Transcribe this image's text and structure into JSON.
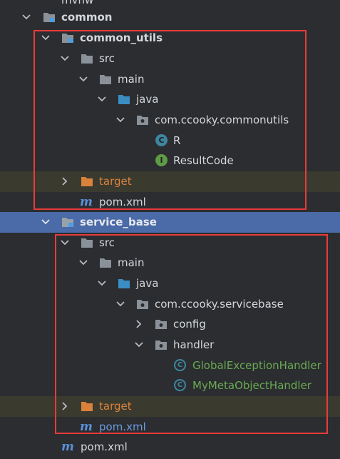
{
  "tree": {
    "top_partial": "mvnw",
    "common": "common",
    "common_utils": "common_utils",
    "src": "src",
    "main": "main",
    "java": "java",
    "pkg1": "com.ccooky.commonutils",
    "class_r": "R",
    "class_r_letter": "C",
    "result_code": "ResultCode",
    "result_code_letter": "I",
    "target": "target",
    "pom": "pom.xml",
    "maven_letter": "m",
    "service_base": "service_base",
    "src2": "src",
    "main2": "main",
    "java2": "java",
    "pkg2": "com.ccooky.servicebase",
    "config": "config",
    "handler": "handler",
    "geh": "GlobalExceptionHandler",
    "geh_letter": "C",
    "mmoh": "MyMetaObjectHandler",
    "mmoh_letter": "C",
    "target2": "target",
    "pom2": "pom.xml",
    "pom3": "pom.xml"
  },
  "colors": {
    "background": "#2b2d30",
    "selection": "#4a6aa8",
    "highlight_box": "#e83b3b",
    "excluded_folder": "#d9823b",
    "class_icon": "#3e86a0",
    "interface_icon": "#5f9b45"
  }
}
